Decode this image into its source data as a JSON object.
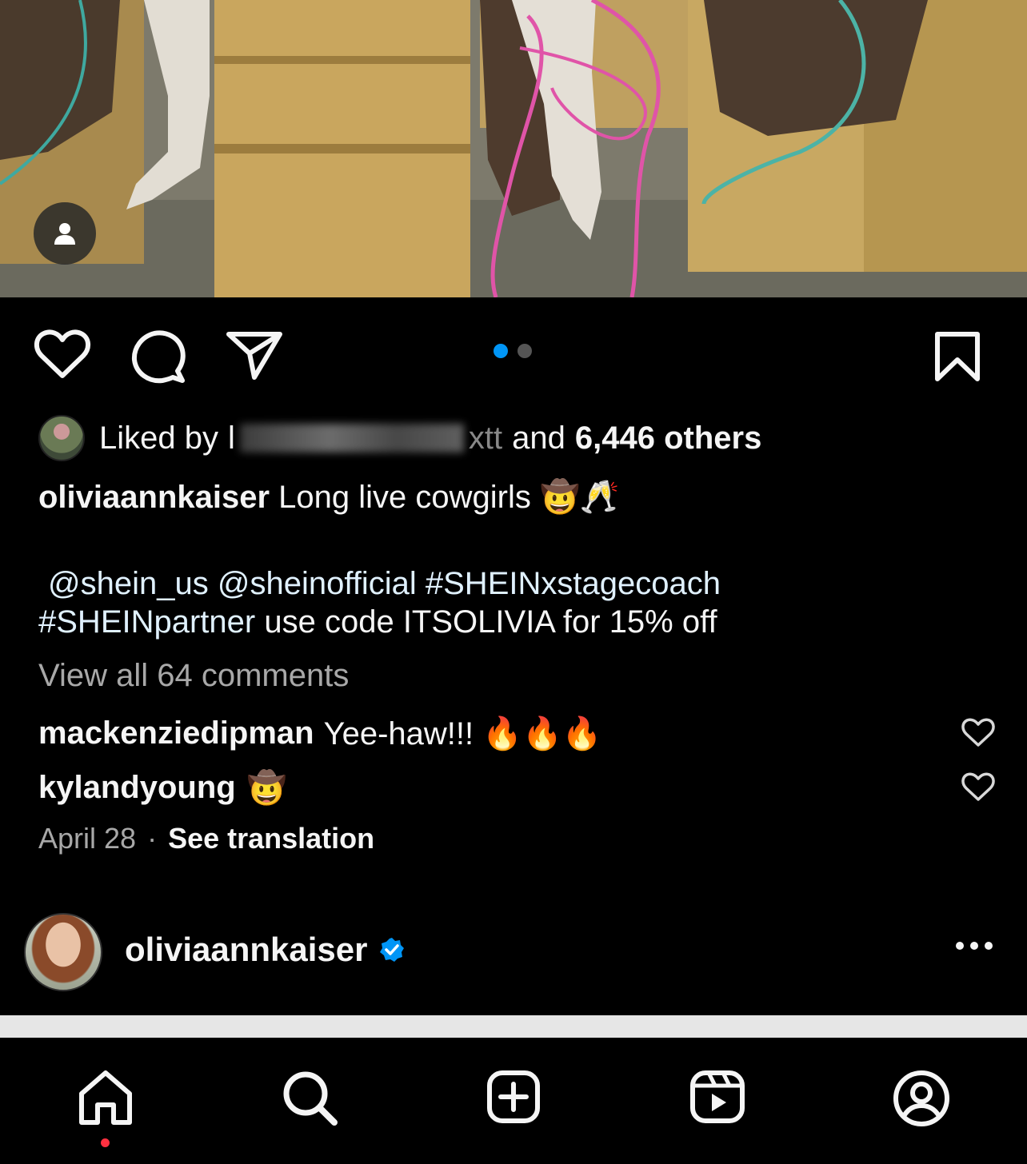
{
  "post": {
    "liked_by_prefix": "Liked by",
    "liked_by_user_visible": "l",
    "liked_by_user_tail": "xtt",
    "liked_by_and": "and",
    "liked_by_count": "6,446 others",
    "caption": {
      "username": "oliviaannkaiser",
      "text": "Long live cowgirls 🤠🥂",
      "mention1": "@shein_us",
      "mention2": "@sheinofficial",
      "hashtag1": "#SHEINxstagecoach",
      "hashtag2": "#SHEINpartner",
      "tail": "use code ITSOLIVIA for 15% off"
    },
    "view_all_comments": "View all 64 comments",
    "comments": [
      {
        "username": "mackenziedipman",
        "text": "Yee-haw!!! 🔥🔥🔥"
      },
      {
        "username": "kylandyoung",
        "text": "🤠"
      }
    ],
    "date": "April 28",
    "separator": "·",
    "see_translation": "See translation",
    "carousel": {
      "count": 2,
      "active_index": 0
    }
  },
  "next_post": {
    "username": "oliviaannkaiser",
    "verified": true
  },
  "icons": {
    "like": "heart-icon",
    "comment": "comment-bubble-icon",
    "share": "paper-plane-icon",
    "save": "bookmark-icon",
    "tag": "person-tag-icon",
    "more": "more-horizontal-icon",
    "home": "home-icon",
    "search": "search-icon",
    "new_post": "add-square-icon",
    "reels": "reels-icon",
    "profile": "profile-icon"
  },
  "colors": {
    "background": "#000000",
    "text": "#f5f5f5",
    "muted": "#a8a8a8",
    "link": "#e0f1ff",
    "accent": "#0095f6",
    "notification": "#ff3040"
  }
}
